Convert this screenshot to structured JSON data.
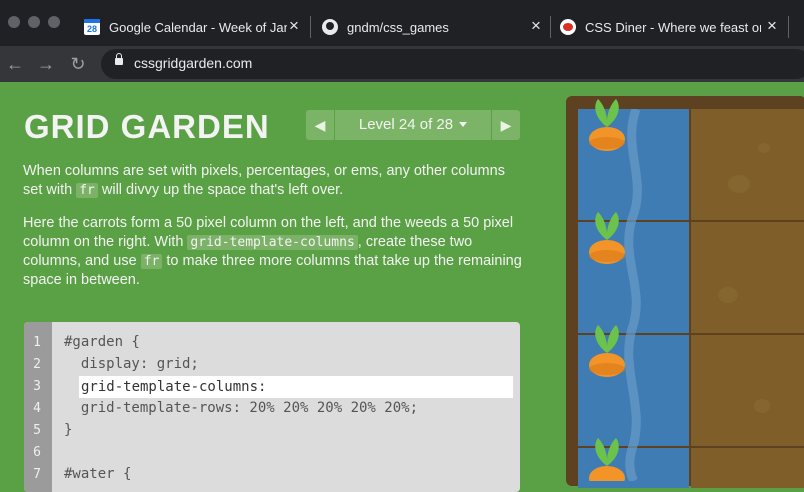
{
  "browser": {
    "tabs": [
      {
        "title": "Google Calendar - Week of Jan",
        "icon": "google-calendar-icon",
        "favicon_text": "28"
      },
      {
        "title": "gndm/css_games",
        "icon": "github-icon"
      },
      {
        "title": "CSS Diner - Where we feast on",
        "icon": "css-diner-icon"
      }
    ],
    "close_glyph": "×",
    "url": "cssgridgarden.com",
    "back_glyph": "←",
    "forward_glyph": "→",
    "reload_glyph": "↻"
  },
  "game": {
    "logo": "GRID GARDEN",
    "level_label": "Level 24 of 28",
    "prev_glyph": "◀",
    "next_glyph": "▶",
    "instructions": [
      {
        "before": "When columns are set with pixels, percentages, or ems, any other columns set with ",
        "code": "fr",
        "after": " will divvy up the space that's left over."
      },
      {
        "before": "Here the carrots form a 50 pixel column on the left, and the weeds a 50 pixel column on the right. With ",
        "code": "grid-template-columns",
        "middle": ", create these two columns, and use ",
        "code2": "fr",
        "after": " to make three more columns that take up the remaining space in between."
      }
    ],
    "code_lines": [
      {
        "num": "1",
        "text": "#garden {"
      },
      {
        "num": "2",
        "text": "  display: grid;"
      },
      {
        "num": "3",
        "text": ""
      },
      {
        "num": "4",
        "text": "  grid-template-rows: 20% 20% 20% 20% 20%;"
      },
      {
        "num": "5",
        "text": "}"
      },
      {
        "num": "6",
        "text": ""
      },
      {
        "num": "7",
        "text": "#water {"
      }
    ],
    "editor_input": {
      "label": "grid-template-columns:",
      "value": ""
    }
  },
  "colors": {
    "page_bg": "#5aa045",
    "water": "#3f7cb3",
    "soil": "#7f5e29",
    "carrot": "#f29427",
    "leaf": "#6cc24a"
  }
}
